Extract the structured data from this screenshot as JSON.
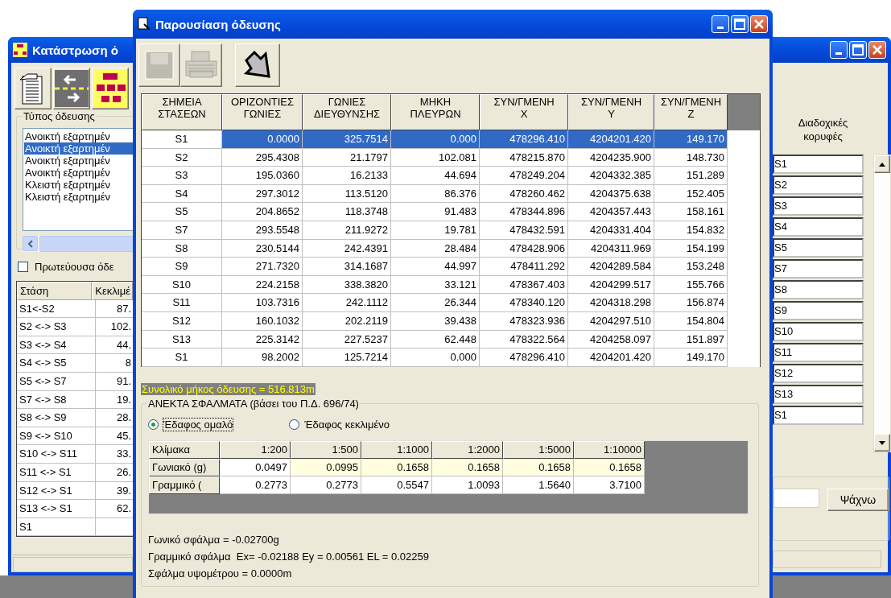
{
  "back_window": {
    "title": "Κατάστρωση ό",
    "toolbar": [
      {
        "kind": "document"
      },
      {
        "kind": "arrows"
      },
      {
        "kind": "hierarchy"
      }
    ],
    "traverse_type": {
      "label": "Τύπος όδευσης",
      "items": [
        {
          "label": "Ανοικτή εξαρτημέν",
          "selected": false
        },
        {
          "label": "Ανοικτή εξαρτημέν",
          "selected": true
        },
        {
          "label": "Ανοικτή εξαρτημέν",
          "selected": false
        },
        {
          "label": "Ανοικτή εξαρτημέν",
          "selected": false
        },
        {
          "label": "Κλειστή εξαρτημέν",
          "selected": false
        },
        {
          "label": "Κλειστή εξαρτημέν",
          "selected": false
        }
      ]
    },
    "primary_traverse": {
      "label": "Πρωτεύουσα όδε",
      "checked": false
    },
    "legs_table": {
      "columns": [
        "Στάση",
        "Κεκλιμέ"
      ],
      "rows": [
        [
          "S1<-S2",
          "87."
        ],
        [
          "S2 <-> S3",
          "102."
        ],
        [
          "S3 <-> S4",
          "44."
        ],
        [
          "S4 <-> S5",
          "8"
        ],
        [
          "S5 <-> S7",
          "91."
        ],
        [
          "S7 <-> S8",
          "19."
        ],
        [
          "S8 <-> S9",
          "28."
        ],
        [
          "S9 <-> S10",
          "45."
        ],
        [
          "S10 <-> S11",
          "33."
        ],
        [
          "S11 <-> S1",
          "26."
        ],
        [
          "S12 <-> S1",
          "39."
        ],
        [
          "S13 <-> S1",
          "62."
        ],
        [
          "S1"
        ]
      ]
    },
    "vertices_label": "Διαδοχικές\nκορυφές",
    "vertices": [
      "S1",
      "S2",
      "S3",
      "S4",
      "S5",
      "S7",
      "S8",
      "S9",
      "S10",
      "S11",
      "S12",
      "S13",
      "S1"
    ],
    "search_button": "Ψάχνω"
  },
  "dialog": {
    "title": "Παρουσίαση όδευσης",
    "toolbar": [
      {
        "kind": "save",
        "disabled": true
      },
      {
        "kind": "print",
        "disabled": true
      },
      {
        "kind": "exit",
        "disabled": false
      }
    ],
    "stations_table": {
      "columns": [
        "ΣΗΜΕΙΑ\nΣΤΑΣΕΩΝ",
        "ΟΡΙΖΟΝΤΙΕΣ\nΓΩΝΙΕΣ",
        "ΓΩΝΙΕΣ\nΔΙΕΥΘΥΝΣΗΣ",
        "ΜΗΚΗ\nΠΛΕΥΡΩΝ",
        "ΣΥΝ/ΓΜΕΝΗ\nX",
        "ΣΥΝ/ΓΜΕΝΗ\nY",
        "ΣΥΝ/ΓΜΕΝΗ\nZ"
      ],
      "rows": [
        {
          "cells": [
            "S1",
            "0.0000",
            "325.7514",
            "0.000",
            "478296.410",
            "4204201.420",
            "149.170"
          ],
          "selected": true
        },
        {
          "cells": [
            "S2",
            "295.4308",
            "21.1797",
            "102.081",
            "478215.870",
            "4204235.900",
            "148.730"
          ],
          "selected": false
        },
        {
          "cells": [
            "S3",
            "195.0360",
            "16.2133",
            "44.694",
            "478249.204",
            "4204332.385",
            "151.289"
          ],
          "selected": false
        },
        {
          "cells": [
            "S4",
            "297.3012",
            "113.5120",
            "86.376",
            "478260.462",
            "4204375.638",
            "152.405"
          ],
          "selected": false
        },
        {
          "cells": [
            "S5",
            "204.8652",
            "118.3748",
            "91.483",
            "478344.896",
            "4204357.443",
            "158.161"
          ],
          "selected": false
        },
        {
          "cells": [
            "S7",
            "293.5548",
            "211.9272",
            "19.781",
            "478432.591",
            "4204331.404",
            "154.832"
          ],
          "selected": false
        },
        {
          "cells": [
            "S8",
            "230.5144",
            "242.4391",
            "28.484",
            "478428.906",
            "4204311.969",
            "154.199"
          ],
          "selected": false
        },
        {
          "cells": [
            "S9",
            "271.7320",
            "314.1687",
            "44.997",
            "478411.292",
            "4204289.584",
            "153.248"
          ],
          "selected": false
        },
        {
          "cells": [
            "S10",
            "224.2158",
            "338.3820",
            "33.121",
            "478367.403",
            "4204299.517",
            "155.766"
          ],
          "selected": false
        },
        {
          "cells": [
            "S11",
            "103.7316",
            "242.1112",
            "26.344",
            "478340.120",
            "4204318.298",
            "156.874"
          ],
          "selected": false
        },
        {
          "cells": [
            "S12",
            "160.1032",
            "202.2119",
            "39.438",
            "478323.936",
            "4204297.510",
            "154.804"
          ],
          "selected": false
        },
        {
          "cells": [
            "S13",
            "225.3142",
            "227.5237",
            "62.448",
            "478322.564",
            "4204258.097",
            "151.897"
          ],
          "selected": false
        },
        {
          "cells": [
            "S1",
            "98.2002",
            "125.7214",
            "0.000",
            "478296.410",
            "4204201.420",
            "149.170"
          ],
          "selected": false
        }
      ]
    },
    "total_length": "Συνολικό μήκος όδευσης = 516.813m",
    "tolerances": {
      "title": "ΑΝΕΚΤΑ ΣΦΑΛΜΑΤΑ (βάσει του Π.Δ. 696/74)",
      "terrain": [
        {
          "label": "Έδαφος ομαλό",
          "selected": true
        },
        {
          "label": "Έδαφος κεκλιμένο",
          "selected": false
        }
      ],
      "scale_table": {
        "columns": [
          "Κλίμακα",
          "1:200",
          "1:500",
          "1:1000",
          "1:2000",
          "1:5000",
          "1:10000"
        ],
        "rows": [
          {
            "cells": [
              "Γωνιακό (g)",
              "0.0497",
              "0.0995",
              "0.1658",
              "0.1658",
              "0.1658",
              "0.1658"
            ],
            "highlighted": true
          },
          {
            "cells": [
              "Γραμμικό (",
              "0.2773",
              "0.2773",
              "0.5547",
              "1.0093",
              "1.5640",
              "3.7100"
            ],
            "highlighted": false
          }
        ]
      },
      "results": [
        "Γωνικό σφάλμα = -0.02700g",
        "Γραμμικό σφάλμα  Ex= -0.02188 Ey = 0.00561 EL = 0.02259",
        "Σφάλμα υψομέτρου = 0.0000m"
      ]
    }
  }
}
